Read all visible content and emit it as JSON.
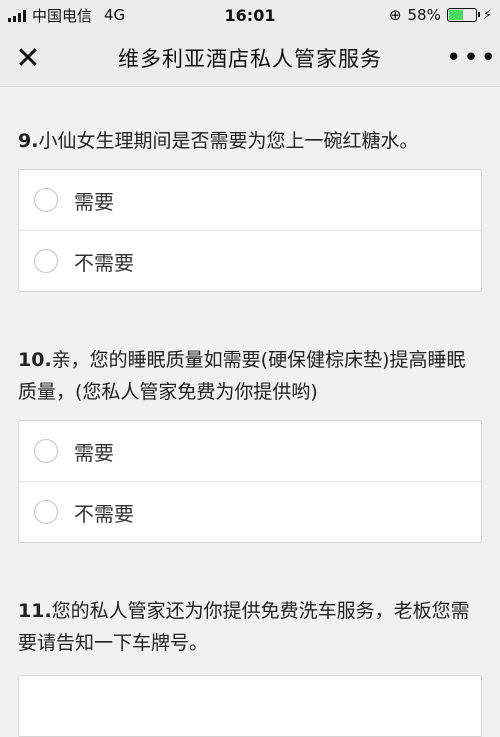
{
  "status_bar": {
    "carrier": "中国电信",
    "network": "4G",
    "time": "16:01",
    "battery": "58%",
    "battery_level": 0.58
  },
  "nav": {
    "title": "维多利亚酒店私人管家服务"
  },
  "questions": [
    {
      "number": "9.",
      "text": "小仙女生理期间是否需要为您上一碗红糖水。",
      "options": [
        "需要",
        "不需要"
      ]
    },
    {
      "number": "10.",
      "text": "亲，您的睡眠质量如需要(硬保健棕床垫)提高睡眠质量，(您私人管家免费为你提供哟)",
      "options": [
        "需要",
        "不需要"
      ]
    },
    {
      "number": "11.",
      "text": "您的私人管家还为你提供免费洗车服务，老板您需要请告知一下车牌号。"
    }
  ],
  "colors": {
    "battery": "#4cd964",
    "background": "#f1f1f1"
  }
}
